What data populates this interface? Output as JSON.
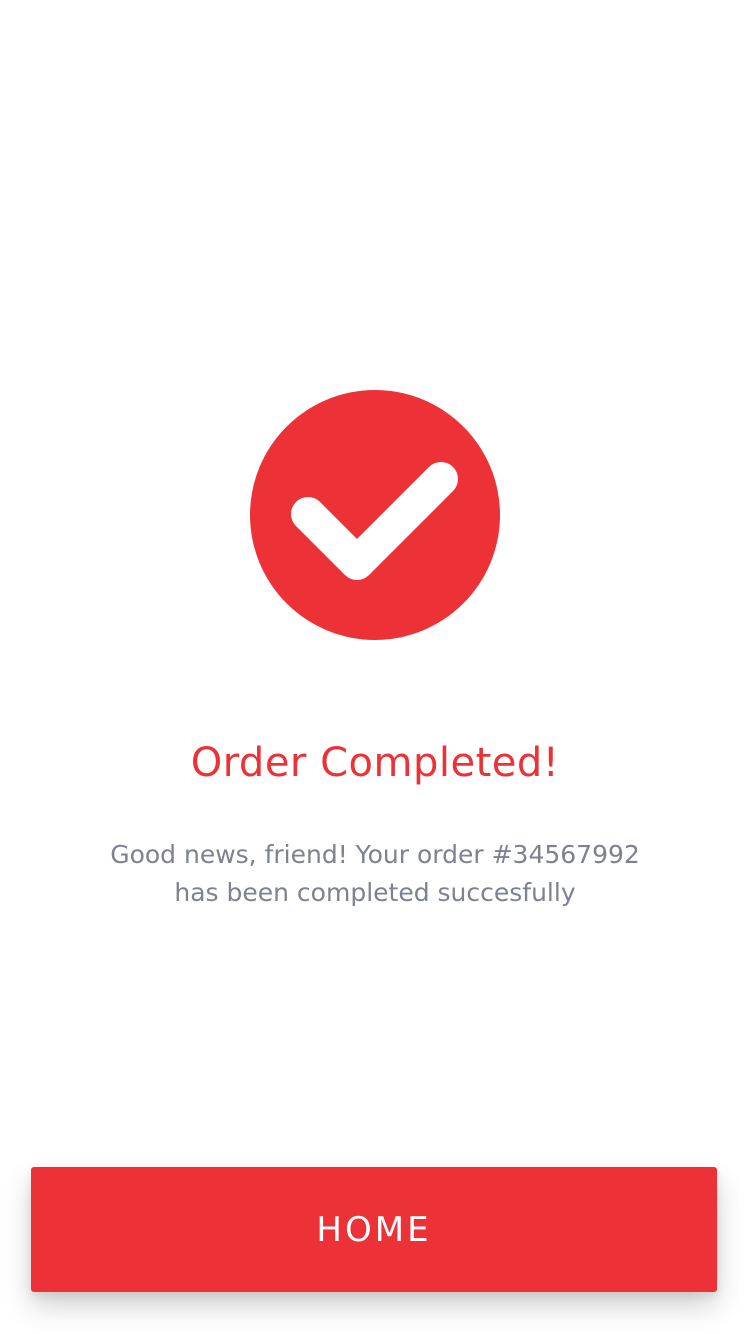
{
  "status": {
    "icon": "check-circle-icon",
    "accent_color": "#ED3237"
  },
  "title": "Order Completed!",
  "message": {
    "line1": "Good news, friend! Your order #34567992",
    "line2": "has been completed succesfully"
  },
  "home_button": {
    "label": "HOME",
    "color": "#ED3237"
  }
}
